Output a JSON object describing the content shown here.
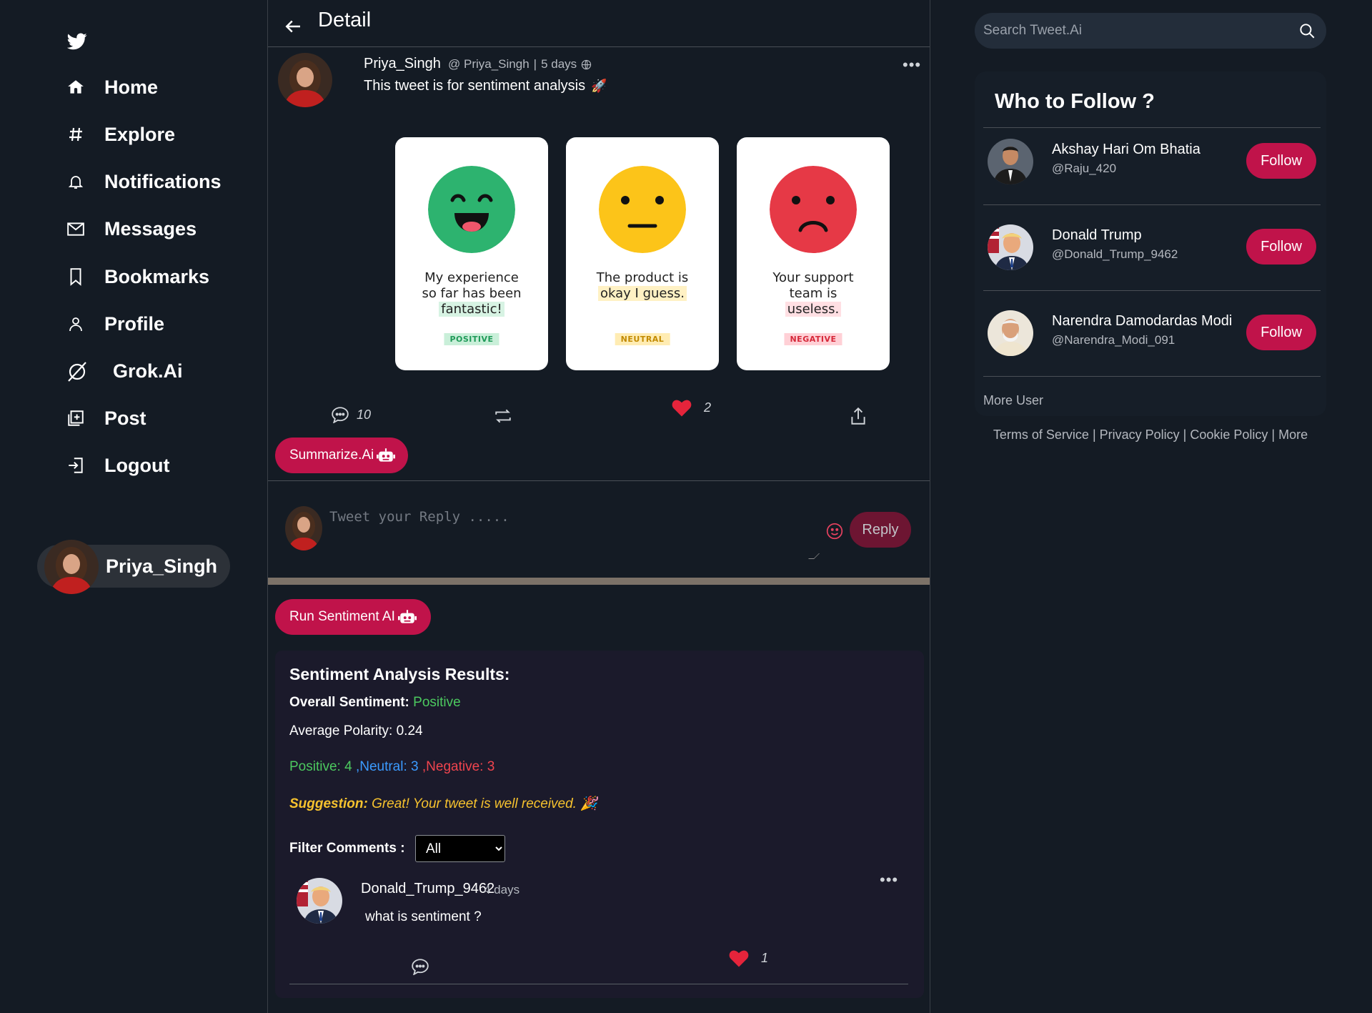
{
  "sidebar": {
    "logo_icon": "twitter-bird-icon",
    "items": [
      {
        "label": "Home",
        "icon": "home-icon"
      },
      {
        "label": "Explore",
        "icon": "hashtag-icon"
      },
      {
        "label": "Notifications",
        "icon": "bell-icon"
      },
      {
        "label": "Messages",
        "icon": "mail-icon"
      },
      {
        "label": "Bookmarks",
        "icon": "bookmark-icon"
      },
      {
        "label": "Profile",
        "icon": "user-icon"
      },
      {
        "label": "Grok.Ai",
        "icon": "grok-icon"
      },
      {
        "label": "Post",
        "icon": "post-icon"
      },
      {
        "label": "Logout",
        "icon": "logout-icon"
      }
    ],
    "current_user": "Priya_Singh"
  },
  "detail": {
    "title": "Detail",
    "post": {
      "name": "Priya_Singh",
      "handle": "@ Priya_Singh",
      "separator": "|",
      "time": "5 days",
      "text": "This tweet is for sentiment analysis",
      "text_emoji": "🚀",
      "cards": [
        {
          "line1": "My experience",
          "line2": "so far has been",
          "highlight": "fantastic!",
          "tag": "POSITIVE",
          "face_color": "#2db36f",
          "tag_bg": "#c9efd9",
          "tag_color": "#1f9a58",
          "hl_bg": "#d7f3e3"
        },
        {
          "line1": "The product is",
          "line2": "",
          "highlight": "okay I guess.",
          "tag": "NEUTRAL",
          "face_color": "#fcc419",
          "tag_bg": "#ffecb3",
          "tag_color": "#c28a00",
          "hl_bg": "#fff1c4"
        },
        {
          "line1": "Your support",
          "line2": "team is",
          "highlight": "useless.",
          "tag": "NEGATIVE",
          "face_color": "#e63946",
          "tag_bg": "#ffd0d6",
          "tag_color": "#d62839",
          "hl_bg": "#ffdfe3"
        }
      ],
      "comments_count": "10",
      "likes_count": "2"
    },
    "summarize_label": "Summarize.Ai",
    "reply_placeholder": "Tweet your Reply .....",
    "reply_label": "Reply",
    "run_sentiment_label": "Run Sentiment AI",
    "results": {
      "title": "Sentiment Analysis Results:",
      "overall_label": "Overall Sentiment:",
      "overall_value": "Positive",
      "polarity": "Average Polarity: 0.24",
      "positive_label": "Positive: 4",
      "neutral_label": "Neutral: 3",
      "negative_label": "Negative: 3",
      "sep": ",",
      "suggestion_label": "Suggestion:",
      "suggestion_text": "Great! Your tweet is well received.",
      "suggestion_emoji": "🎉",
      "filter_label": "Filter Comments :",
      "filter_selected": "All",
      "colors": {
        "positive": "#4cc95f",
        "neutral": "#3b9bff",
        "negative": "#f0444e",
        "suggestion": "#f6c22e"
      }
    },
    "comment": {
      "name": "Donald_Trump_9462",
      "time": "4 days",
      "text": "what is sentiment ?",
      "likes": "1"
    }
  },
  "right": {
    "search_placeholder": "Search Tweet.Ai",
    "who_to_follow_title": "Who to Follow ?",
    "users": [
      {
        "name": "Akshay Hari Om Bhatia",
        "handle": "@Raju_420",
        "button": "Follow"
      },
      {
        "name": "Donald Trump",
        "handle": "@Donald_Trump_9462",
        "button": "Follow"
      },
      {
        "name": "Narendra Damodardas Modi",
        "handle": "@Narendra_Modi_091",
        "button": "Follow"
      }
    ],
    "more_user": "More User",
    "footer": {
      "terms": "Terms of Service",
      "privacy": "Privacy Policy",
      "cookie": "Cookie Policy",
      "more": "More",
      "sep": " | "
    }
  },
  "colors": {
    "accent": "#c0134a",
    "background": "#141b24",
    "like_red": "#e5243b"
  }
}
